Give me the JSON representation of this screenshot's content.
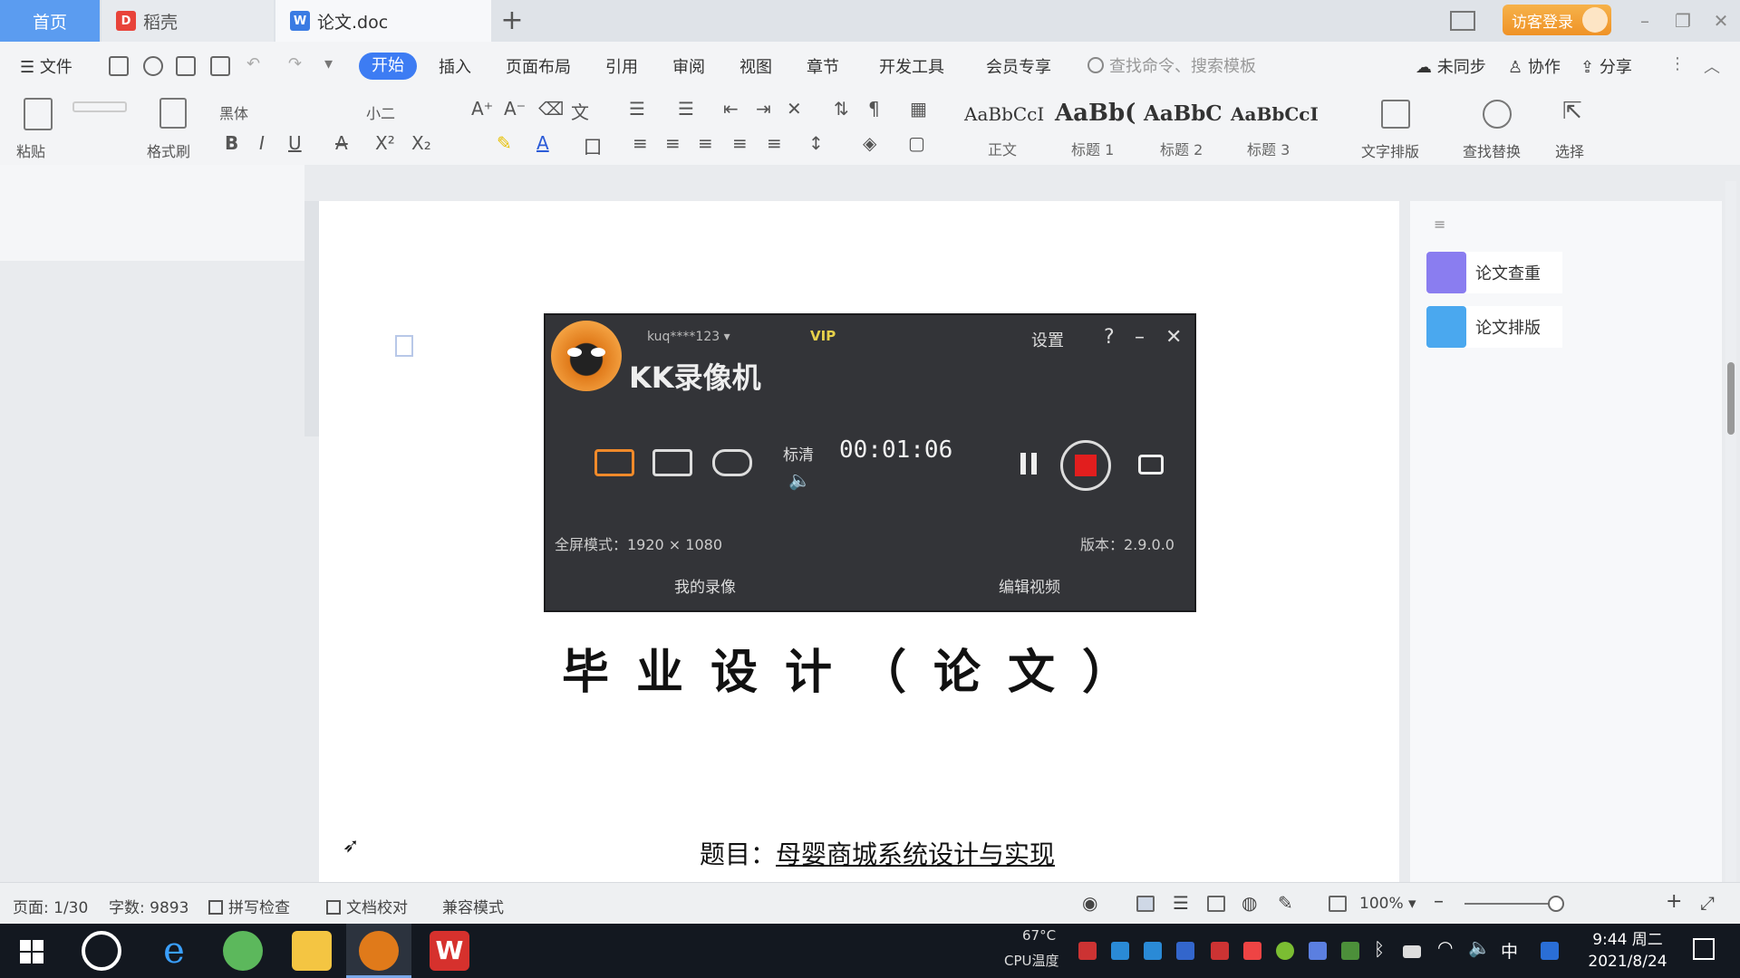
{
  "tabs": {
    "home": "首页",
    "daoke": "稻壳",
    "doc": "论文.doc",
    "new_tab": "+"
  },
  "titlebar": {
    "guest_login": "访客登录"
  },
  "menu": {
    "file": "文件",
    "items": [
      "开始",
      "插入",
      "页面布局",
      "引用",
      "审阅",
      "视图",
      "章节",
      "开发工具",
      "会员专享"
    ],
    "search_placeholder": "查找命令、搜索模板",
    "sync": "未同步",
    "collab": "协作",
    "share": "分享"
  },
  "ribbon": {
    "paste": "粘贴",
    "format_painter": "格式刷",
    "font_name": "黑体",
    "font_size": "小二",
    "bold": "B",
    "underline": "U",
    "styles": [
      {
        "sample": "AaBbCcI",
        "name": "正文"
      },
      {
        "sample": "AaBb(",
        "name": "标题 1"
      },
      {
        "sample": "AaBbC",
        "name": "标题 2"
      },
      {
        "sample": "AaBbCcI",
        "name": "标题 3"
      }
    ],
    "text_layout": "文字排版",
    "find_replace": "查找替换",
    "select": "选择"
  },
  "right_panel": {
    "items": [
      "论文查重",
      "论文排版"
    ]
  },
  "document": {
    "title": "毕业设计（论文）",
    "topic_label": "题目：",
    "topic_value": "母婴商城系统设计与实现"
  },
  "kk_recorder": {
    "app_name": "KK录像机",
    "username": "kuq****123",
    "vip": "VIP",
    "settings": "设置",
    "help": "?",
    "minimize": "–",
    "close": "✕",
    "quality": "标清",
    "timer": "00:01:06",
    "fullscreen_mode": "全屏模式：1920 × 1080",
    "version": "版本：2.9.0.0",
    "my_recordings": "我的录像",
    "edit_video": "编辑视频"
  },
  "statusbar": {
    "page": "页面: 1/30",
    "word_count": "字数: 9893",
    "spell_check": "拼写检查",
    "doc_proof": "文档校对",
    "compat_mode": "兼容模式",
    "zoom": "100%",
    "zoom_out": "–",
    "zoom_in": "+"
  },
  "taskbar": {
    "cpu_temp_top": "67°C",
    "cpu_temp": "CPU温度",
    "ime": "中",
    "time": "9:44 周二",
    "date": "2021/8/24"
  },
  "colors": {
    "accent": "#3d7cf3",
    "tab_home": "#5b9cf0",
    "record_red": "#e21e1e",
    "guest_orange": "#ef9226",
    "taskbar": "#131820"
  }
}
